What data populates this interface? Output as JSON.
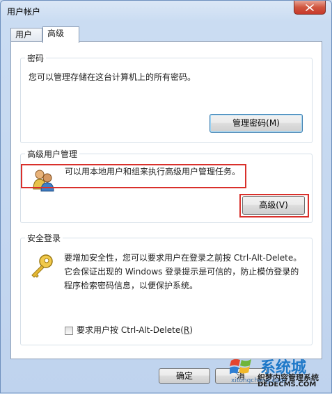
{
  "window": {
    "title": "用户帐户"
  },
  "tabs": [
    {
      "label": "用户",
      "active": false
    },
    {
      "label": "高级",
      "active": true
    }
  ],
  "password_group": {
    "title": "密码",
    "description": "您可以管理存储在这台计算机上的所有密码。",
    "button": "管理密码(M)"
  },
  "advanced_group": {
    "title": "高级用户管理",
    "description": "可以用本地用户和组来执行高级用户管理任务。",
    "button": "高级(V)"
  },
  "secure_group": {
    "title": "安全登录",
    "description": [
      "要增加安全性，您可以要求用户在登录之前按 Ctrl-Alt-Delete。",
      "它会保证出现的 Windows 登录提示是可信的，防止模仿登录的",
      "程序检索密码信息，以便保护系统。"
    ],
    "checkbox_label": "要求用户按 Ctrl-Alt-Delete(",
    "checkbox_key": "R",
    "checkbox_close": ")",
    "checkbox_checked": false
  },
  "footer": {
    "ok": "确定",
    "cancel_partial": "消"
  },
  "watermark": {
    "brand": "系统城",
    "line1": "织梦内容管理系统",
    "line2": "DEDECMS.COM",
    "line3": "xitongcheng.com"
  },
  "icons": {
    "close": "close-icon",
    "users": "users-icon",
    "key": "key-icon"
  },
  "colors": {
    "highlight": "#d9302b",
    "close": "#c7382a"
  }
}
